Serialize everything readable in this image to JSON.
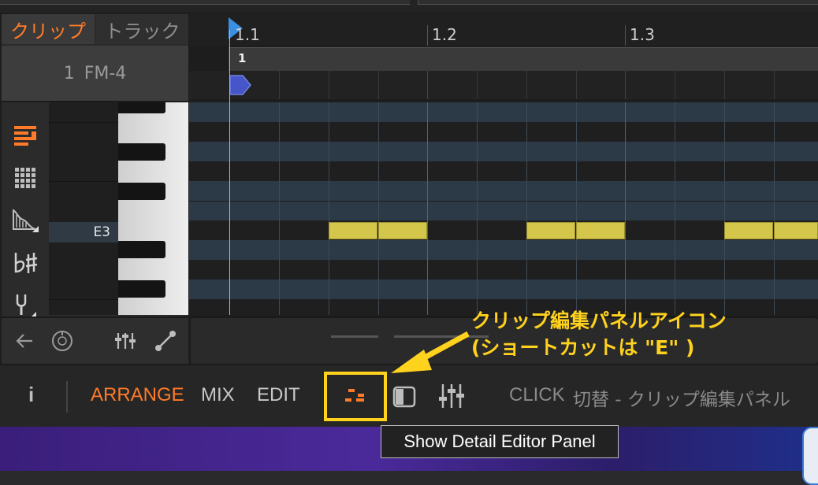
{
  "tabs": {
    "clip": "クリップ",
    "track": "トラック"
  },
  "clip": {
    "number": "1",
    "name": "FM-4"
  },
  "ruler": {
    "bar_1": "1.1",
    "bar_2": "1.2",
    "bar_3": "1.3"
  },
  "clip_lane": {
    "number": "1"
  },
  "piano": {
    "note_label": "E3"
  },
  "bottombar": {
    "info_icon": "i",
    "arrange": "ARRANGE",
    "mix": "MIX",
    "edit": "EDIT",
    "click_label": "CLICK",
    "click_desc": "切替 - クリップ編集パネル"
  },
  "annotation": {
    "line1": "クリップ編集パネルアイコン",
    "line2": "(ショートカットは \"E\" )"
  },
  "tooltip": "Show Detail Editor Panel",
  "colors": {
    "accent": "#ff7b2a",
    "note": "#d4c64a",
    "highlight": "#ffd21e",
    "playhead_marker": "#3a8fe0"
  },
  "icons": {
    "tools": [
      "note-editor-icon",
      "grid-icon",
      "expression-icon",
      "sharp-flat-icon",
      "tuning-fork-icon"
    ],
    "left_bottom": [
      "back-arrow-icon",
      "dial-icon",
      "mixer-sliders-icon",
      "curve-icon"
    ]
  }
}
